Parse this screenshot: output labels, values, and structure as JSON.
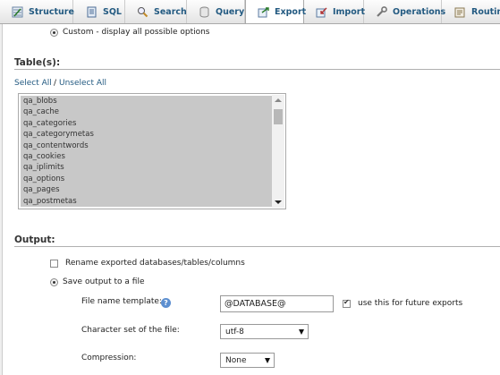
{
  "tabs": [
    {
      "label": "Structure",
      "icon": "structure-icon"
    },
    {
      "label": "SQL",
      "icon": "sql-icon"
    },
    {
      "label": "Search",
      "icon": "search-icon"
    },
    {
      "label": "Query",
      "icon": "query-icon"
    },
    {
      "label": "Export",
      "icon": "export-icon",
      "active": true
    },
    {
      "label": "Import",
      "icon": "import-icon"
    },
    {
      "label": "Operations",
      "icon": "wrench-icon"
    },
    {
      "label": "Routine",
      "icon": "routines-icon"
    }
  ],
  "format_options": {
    "custom_label": "Custom - display all possible options"
  },
  "tables_section": {
    "heading": "Table(s):",
    "select_all": "Select All",
    "separator": "/",
    "unselect_all": "Unselect All",
    "tables": [
      "qa_blobs",
      "qa_cache",
      "qa_categories",
      "qa_categorymetas",
      "qa_contentwords",
      "qa_cookies",
      "qa_iplimits",
      "qa_options",
      "qa_pages",
      "qa_postmetas"
    ]
  },
  "output_section": {
    "heading": "Output:",
    "rename_label": "Rename exported databases/tables/columns",
    "save_label": "Save output to a file",
    "file_name_label": "File name template:",
    "file_name_value": "@DATABASE@",
    "future_label": "use this for future exports",
    "charset_label": "Character set of the file:",
    "charset_value": "utf-8",
    "compression_label": "Compression:",
    "compression_value": "None"
  },
  "colors": {
    "link": "#235a81",
    "selection_bg": "#c8c8c8"
  }
}
